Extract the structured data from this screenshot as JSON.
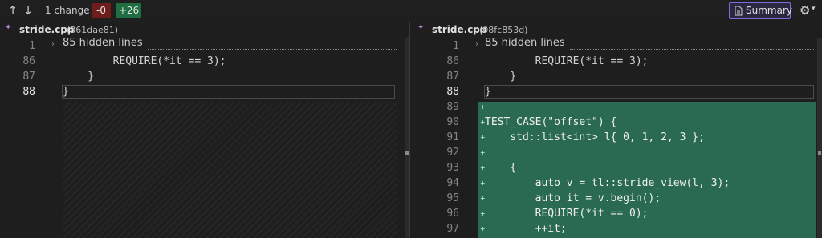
{
  "toolbar": {
    "up_icon": "arrow-up-icon",
    "down_icon": "arrow-down-icon",
    "change_count": "1 change",
    "deletions": "-0",
    "additions": "+26",
    "summary_label": "Summary",
    "settings_icon": "gear-icon"
  },
  "left_file": {
    "name": "stride.cpp",
    "hash": "(361dae81)",
    "hidden_label": "85 hidden lines",
    "lines": [
      {
        "num": "1",
        "code": ""
      },
      {
        "num": "86",
        "code": "        REQUIRE(*it == 3);"
      },
      {
        "num": "87",
        "code": "    }"
      },
      {
        "num": "88",
        "code": "}"
      }
    ]
  },
  "right_file": {
    "name": "stride.cpp",
    "hash": "(08fc853d)",
    "hidden_label": "85 hidden lines",
    "lines": [
      {
        "num": "1",
        "code": ""
      },
      {
        "num": "86",
        "code": "        REQUIRE(*it == 3);"
      },
      {
        "num": "87",
        "code": "    }"
      },
      {
        "num": "88",
        "code": "}"
      },
      {
        "num": "89",
        "code": ""
      },
      {
        "num": "90",
        "code": "TEST_CASE(\"offset\") {"
      },
      {
        "num": "91",
        "code": "    std::list<int> l{ 0, 1, 2, 3 };"
      },
      {
        "num": "92",
        "code": ""
      },
      {
        "num": "93",
        "code": "    {"
      },
      {
        "num": "94",
        "code": "        auto v = tl::stride_view(l, 3);"
      },
      {
        "num": "95",
        "code": "        auto it = v.begin();"
      },
      {
        "num": "96",
        "code": "        REQUIRE(*it == 0);"
      },
      {
        "num": "97",
        "code": "        ++it;"
      }
    ]
  }
}
